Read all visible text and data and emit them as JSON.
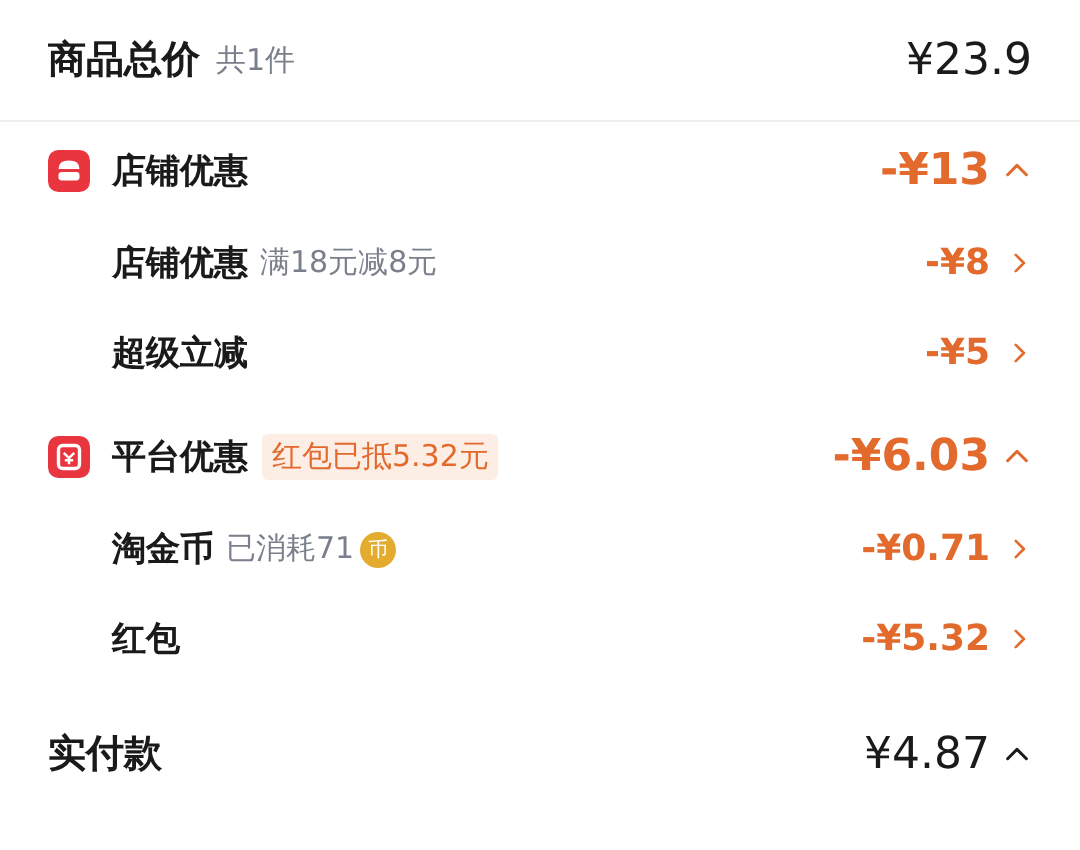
{
  "summary": {
    "label": "商品总价",
    "count": "共1件",
    "amount": "¥23.9"
  },
  "sections": [
    {
      "kind": "store",
      "title": "店铺优惠",
      "amount": "-¥13",
      "expanded": true,
      "items": [
        {
          "label": "店铺优惠",
          "note": "满18元减8元",
          "amount": "-¥8"
        },
        {
          "label": "超级立减",
          "amount": "-¥5"
        }
      ]
    },
    {
      "kind": "platform",
      "title": "平台优惠",
      "tag": "红包已抵5.32元",
      "amount": "-¥6.03",
      "expanded": true,
      "items": [
        {
          "label": "淘金币",
          "note": "已消耗71",
          "coin_badge": "币",
          "amount": "-¥0.71"
        },
        {
          "label": "红包",
          "amount": "-¥5.32"
        }
      ]
    }
  ],
  "total": {
    "label": "实付款",
    "amount": "¥4.87",
    "expanded": true
  }
}
